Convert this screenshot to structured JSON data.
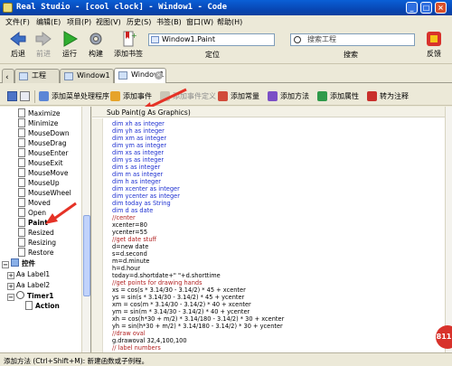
{
  "window": {
    "title": "Real Studio - [cool clock] - Window1 - Code"
  },
  "menu": [
    "文件(F)",
    "编辑(E)",
    "项目(P)",
    "视图(V)",
    "历史(S)",
    "书签(B)",
    "窗口(W)",
    "帮助(H)"
  ],
  "toolbar": {
    "back": "后退",
    "forward": "前进",
    "run": "运行",
    "build": "构建",
    "add_bookmark": "添加书签",
    "location_value": "Window1.Paint",
    "location_label": "定位",
    "search_placeholder": "搜索工程",
    "search_label": "搜索",
    "feedback": "反馈"
  },
  "tabs": [
    {
      "label": "工程"
    },
    {
      "label": "Window1"
    },
    {
      "label": "Window1"
    }
  ],
  "editor_toolbar": [
    {
      "label": "添加菜单处理程序"
    },
    {
      "label": "添加事件"
    },
    {
      "label": "添加事件定义"
    },
    {
      "label": "添加常量"
    },
    {
      "label": "添加方法"
    },
    {
      "label": "添加属性"
    },
    {
      "label": "转为注释"
    }
  ],
  "tree": [
    {
      "label": "Maximize"
    },
    {
      "label": "Minimize"
    },
    {
      "label": "MouseDown"
    },
    {
      "label": "MouseDrag"
    },
    {
      "label": "MouseEnter"
    },
    {
      "label": "MouseExit"
    },
    {
      "label": "MouseMove"
    },
    {
      "label": "MouseUp"
    },
    {
      "label": "MouseWheel"
    },
    {
      "label": "Moved"
    },
    {
      "label": "Open"
    },
    {
      "label": "Paint"
    },
    {
      "label": "Resized"
    },
    {
      "label": "Resizing"
    },
    {
      "label": "Restore"
    }
  ],
  "tree_groups": {
    "controls": "控件",
    "label1": "Aa Label1",
    "label2": "Aa Label2",
    "timer1": "Timer1",
    "action": "Action"
  },
  "editor": {
    "signature": "Sub Paint(g As Graphics)",
    "lines": [
      {
        "text": "dim xh as integer",
        "kind": "kw"
      },
      {
        "text": "dim yh as integer",
        "kind": "kw"
      },
      {
        "text": "dim xm as integer",
        "kind": "kw"
      },
      {
        "text": "dim ym as integer",
        "kind": "kw"
      },
      {
        "text": "dim xs as integer",
        "kind": "kw"
      },
      {
        "text": "dim ys as integer",
        "kind": "kw"
      },
      {
        "text": "dim s as integer",
        "kind": "kw"
      },
      {
        "text": "dim m as integer",
        "kind": "kw"
      },
      {
        "text": "dim h as integer",
        "kind": "kw"
      },
      {
        "text": "dim xcenter as integer",
        "kind": "kw"
      },
      {
        "text": "dim ycenter as integer",
        "kind": "kw"
      },
      {
        "text": "dim today as String",
        "kind": "kw"
      },
      {
        "text": "dim d as date",
        "kind": "kw"
      },
      {
        "text": "//center",
        "kind": "cm"
      },
      {
        "text": "xcenter=80",
        "kind": "pl"
      },
      {
        "text": "ycenter=55",
        "kind": "pl"
      },
      {
        "text": "//get date stuff",
        "kind": "cm"
      },
      {
        "text": "d=new date",
        "kind": "pl"
      },
      {
        "text": "s=d.second",
        "kind": "pl"
      },
      {
        "text": "m=d.minute",
        "kind": "pl"
      },
      {
        "text": "h=d.hour",
        "kind": "pl"
      },
      {
        "text": "today=d.shortdate+\"  \"+d.shorttime",
        "kind": "pl"
      },
      {
        "text": "//get points for drawing hands",
        "kind": "cm"
      },
      {
        "text": "xs = cos(s * 3.14/30 - 3.14/2) * 45 + xcenter",
        "kind": "pl"
      },
      {
        "text": "ys = sin(s * 3.14/30 - 3.14/2) * 45 + ycenter",
        "kind": "pl"
      },
      {
        "text": "xm = cos(m * 3.14/30 - 3.14/2) * 40 + xcenter",
        "kind": "pl"
      },
      {
        "text": "ym = sin(m * 3.14/30 - 3.14/2) * 40 + ycenter",
        "kind": "pl"
      },
      {
        "text": "xh = cos(h*30 + m/2) * 3.14/180 - 3.14/2) * 30 + xcenter",
        "kind": "pl"
      },
      {
        "text": "yh = sin(h*30 + m/2) * 3.14/180 - 3.14/2) * 30 + ycenter",
        "kind": "pl"
      },
      {
        "text": "//draw oval",
        "kind": "cm"
      },
      {
        "text": "g.drawoval 32,4,100,100",
        "kind": "pl"
      },
      {
        "text": "// label numbers",
        "kind": "cm"
      }
    ]
  },
  "status": "添加方法 (Ctrl+Shift+M): 新建函数或子例程。",
  "badge": "811"
}
